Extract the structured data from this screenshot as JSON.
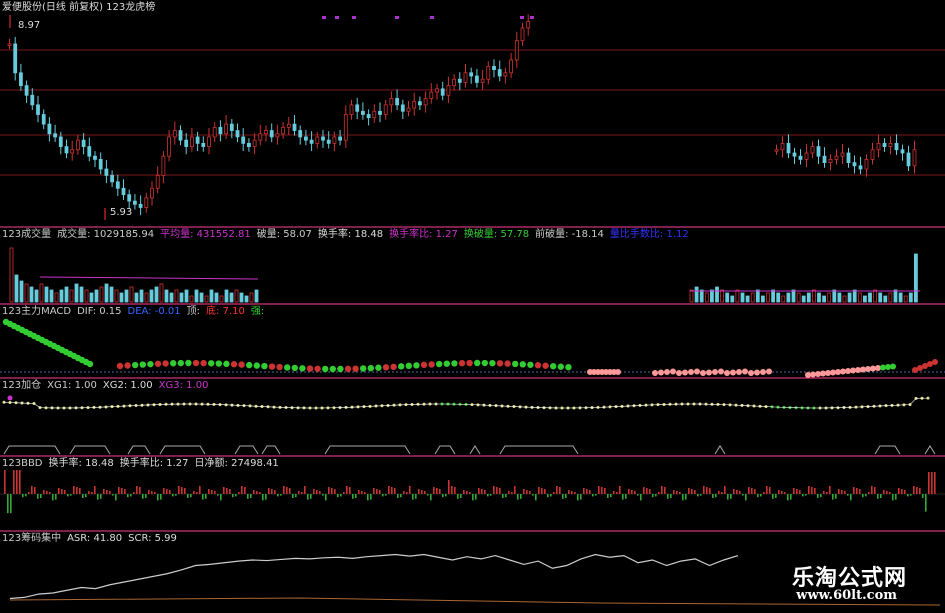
{
  "title": "爱便股份(日线 前复权) 123龙虎榜",
  "price": {
    "high_label": "8.97",
    "low_label": "5.93"
  },
  "panels": {
    "volume": {
      "items": [
        {
          "label": "123成交量",
          "value": "",
          "color": "#cccccc"
        },
        {
          "label": "成交量:",
          "value": "1029185.94",
          "color": "#cccccc"
        },
        {
          "label": "平均量:",
          "value": "431552.81",
          "color": "#cc33cc"
        },
        {
          "label": "破量:",
          "value": "58.07",
          "color": "#cccccc"
        },
        {
          "label": "换手率:",
          "value": "18.48",
          "color": "#dddddd"
        },
        {
          "label": "换手率比:",
          "value": "1.27",
          "color": "#cc33cc"
        },
        {
          "label": "换破量:",
          "value": "57.78",
          "color": "#33cc33"
        },
        {
          "label": "前破量:",
          "value": "-18.14",
          "color": "#cccccc"
        },
        {
          "label": "量比手数比:",
          "value": "1.12",
          "color": "#3333ff"
        }
      ]
    },
    "macd": {
      "items": [
        {
          "label": "123主力MACD",
          "value": "",
          "color": "#cccccc"
        },
        {
          "label": "DIF:",
          "value": "0.15",
          "color": "#cccccc"
        },
        {
          "label": "DEA:",
          "value": "-0.01",
          "color": "#3366ff"
        },
        {
          "label": "顶:",
          "value": "",
          "color": "#cccccc"
        },
        {
          "label": "底:",
          "value": "7.10",
          "color": "#ff3333"
        },
        {
          "label": "强:",
          "value": "",
          "color": "#33cc33"
        }
      ]
    },
    "jiacang": {
      "items": [
        {
          "label": "123加仓",
          "value": "",
          "color": "#cccccc"
        },
        {
          "label": "XG1:",
          "value": "1.00",
          "color": "#cccccc"
        },
        {
          "label": "XG2:",
          "value": "1.00",
          "color": "#dddddd"
        },
        {
          "label": "XG3:",
          "value": "1.00",
          "color": "#cc33cc"
        }
      ]
    },
    "bbd": {
      "items": [
        {
          "label": "123BBD",
          "value": "",
          "color": "#cccccc"
        },
        {
          "label": "换手率:",
          "value": "18.48",
          "color": "#dddddd"
        },
        {
          "label": "换手率比:",
          "value": "1.27",
          "color": "#dddddd"
        },
        {
          "label": "日净额:",
          "value": "27498.41",
          "color": "#dddddd"
        }
      ]
    },
    "chip": {
      "items": [
        {
          "label": "123筹码集中",
          "value": "",
          "color": "#cccccc"
        },
        {
          "label": "ASR:",
          "value": "41.80",
          "color": "#dddddd"
        },
        {
          "label": "SCR:",
          "value": "5.99",
          "color": "#dddddd"
        }
      ]
    }
  },
  "watermark": {
    "name": "乐淘公式网",
    "url": "www.60lt.com"
  },
  "colors": {
    "up": "#cc3333",
    "down": "#66ccdd",
    "grid": "#7a1a1a",
    "divider": "#cc3377",
    "macd_up": "#33cc33",
    "macd_down": "#cc3333",
    "macd_pink": "#ff9999",
    "bbd_up": "#cc3333",
    "bbd_down": "#33aa33",
    "chip_line": "#cccccc",
    "jiacang_dots": "#dddd88",
    "jiacang_green": "#33cc33"
  },
  "chart_data": [
    {
      "type": "candlestick",
      "title": "爱便股份(日线 前复权)",
      "price_range": [
        5.93,
        8.97
      ],
      "closes_left": [
        8.55,
        8.1,
        7.9,
        7.75,
        7.6,
        7.45,
        7.3,
        7.15,
        7.1,
        6.95,
        6.85,
        6.9,
        7.05,
        6.95,
        6.8,
        6.75,
        6.6,
        6.5,
        6.4,
        6.3,
        6.2,
        6.1,
        6.05,
        6.0,
        6.15,
        6.3,
        6.5,
        6.8,
        7.1,
        7.2,
        7.05,
        6.95,
        7.1,
        7.0,
        6.95,
        7.1,
        7.25,
        7.15,
        7.3,
        7.2,
        7.1,
        7.0,
        6.95,
        7.05,
        7.15,
        7.2,
        7.1,
        7.15,
        7.25,
        7.3,
        7.2,
        7.1,
        7.05,
        7.0,
        7.1,
        7.05,
        7.0,
        7.1,
        7.05,
        7.45,
        7.6,
        7.5,
        7.45,
        7.4,
        7.5,
        7.45,
        7.6,
        7.7,
        7.6,
        7.5,
        7.55,
        7.65,
        7.6,
        7.7,
        7.8,
        7.85,
        7.75,
        7.9,
        8.0,
        7.95,
        8.1,
        8.05,
        7.95,
        8.0,
        8.2,
        8.15,
        8.05,
        8.1,
        8.3,
        8.6,
        8.8,
        8.9
      ],
      "closes_right": [
        6.9,
        7.0,
        6.85,
        6.8,
        6.75,
        6.85,
        6.95,
        6.8,
        6.7,
        6.75,
        6.8,
        6.85,
        6.7,
        6.65,
        6.6,
        6.75,
        6.9,
        7.0,
        6.95,
        7.0,
        6.9,
        6.85,
        6.65,
        6.9
      ]
    },
    {
      "type": "bar",
      "title": "123成交量",
      "values_left": [
        0.9,
        0.45,
        0.35,
        0.3,
        0.25,
        0.2,
        0.3,
        0.25,
        0.2,
        0.15,
        0.2,
        0.25,
        0.2,
        0.3,
        0.25,
        0.2,
        0.15,
        0.2,
        0.25,
        0.3,
        0.25,
        0.2,
        0.15,
        0.2,
        0.25,
        0.15,
        0.2,
        0.15,
        0.2,
        0.25,
        0.3,
        0.2,
        0.15,
        0.2,
        0.15,
        0.2,
        0.1,
        0.2,
        0.15,
        0.1,
        0.2,
        0.15,
        0.1,
        0.2,
        0.15,
        0.2,
        0.15,
        0.1,
        0.15,
        0.2
      ],
      "values_right": [
        0.2,
        0.25,
        0.2,
        0.15,
        0.2,
        0.25,
        0.2,
        0.15,
        0.1,
        0.2,
        0.15,
        0.1,
        0.15,
        0.2,
        0.1,
        0.15,
        0.2,
        0.15,
        0.1,
        0.15,
        0.2,
        0.15,
        0.1,
        0.15,
        0.2,
        0.15,
        0.1,
        0.15,
        0.2,
        0.15,
        0.1,
        0.15,
        0.2,
        0.15,
        0.1,
        0.15,
        0.2,
        0.15,
        0.1,
        0.15,
        0.2,
        0.15,
        0.1,
        0.15,
        0.8
      ]
    },
    {
      "type": "line",
      "title": "123筹码集中",
      "values": [
        0.1,
        0.12,
        0.18,
        0.2,
        0.25,
        0.3,
        0.28,
        0.35,
        0.4,
        0.45,
        0.5,
        0.55,
        0.62,
        0.7,
        0.72,
        0.75,
        0.78,
        0.8,
        0.79,
        0.81,
        0.83,
        0.82,
        0.84,
        0.85,
        0.83,
        0.86,
        0.88,
        0.9,
        0.87,
        0.9,
        0.85,
        0.8,
        0.86,
        0.82,
        0.88,
        0.8,
        0.72,
        0.78,
        0.65,
        0.7,
        0.82,
        0.9,
        0.85,
        0.88,
        0.75,
        0.8,
        0.7,
        0.78,
        0.82,
        0.7,
        0.8,
        0.88
      ]
    }
  ]
}
